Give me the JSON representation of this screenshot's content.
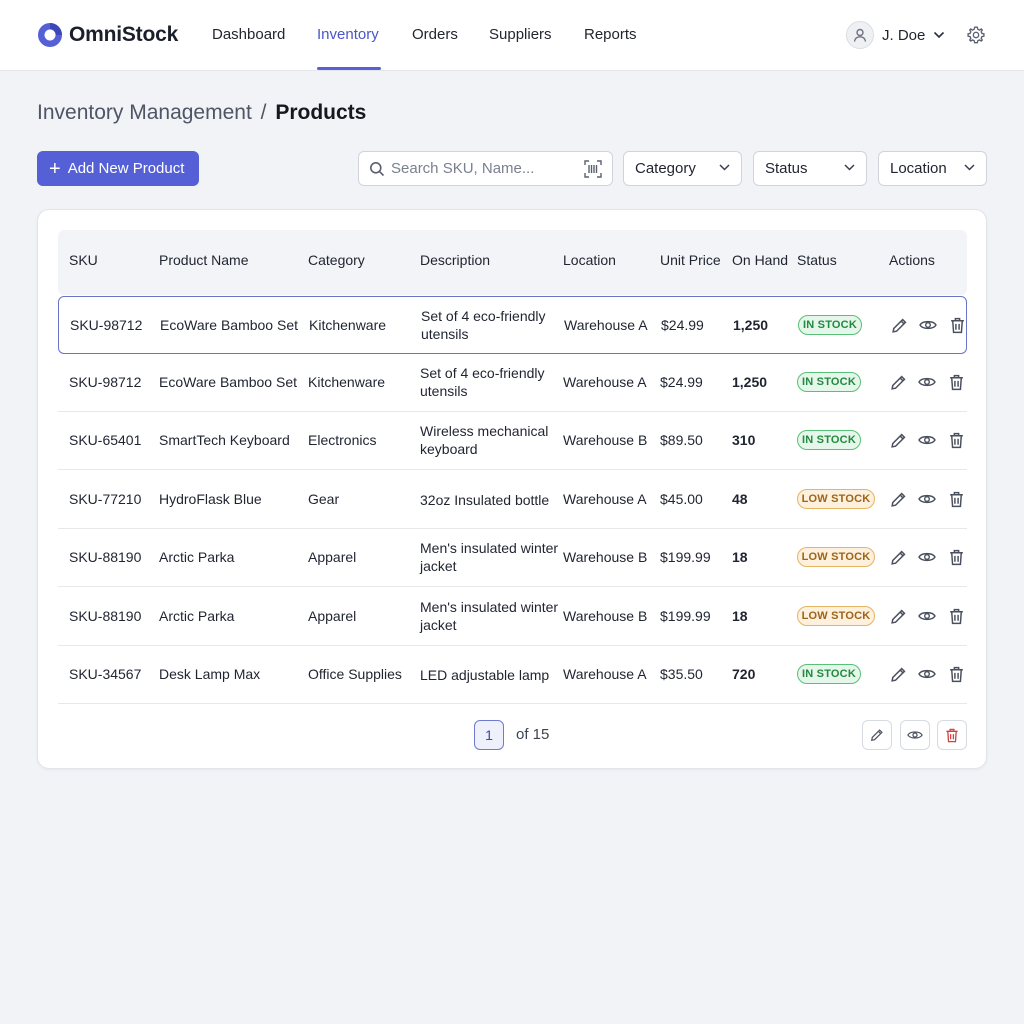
{
  "app": {
    "name": "OmniStock",
    "nav": [
      {
        "label": "Dashboard"
      },
      {
        "label": "Inventory"
      },
      {
        "label": "Orders"
      },
      {
        "label": "Suppliers"
      },
      {
        "label": "Reports"
      }
    ],
    "active_nav": "Inventory",
    "user": {
      "name": "J. Doe"
    }
  },
  "header": {
    "section": "Inventory Management",
    "separator": "/",
    "page": "Products"
  },
  "toolbar": {
    "add_label": "Add New Product",
    "search_placeholder": "Search SKU, Name...",
    "filters": [
      "Category",
      "Status",
      "Location"
    ]
  },
  "table": {
    "columns": [
      "SKU",
      "Product Name",
      "Category",
      "Description",
      "Location",
      "Unit Price",
      "On Hand",
      "Status",
      "Actions"
    ],
    "rows": [
      {
        "sku": "SKU-98712",
        "name": "EcoWare Bamboo Set",
        "category": "Kitchenware",
        "description": "Set of 4 eco-friendly utensils",
        "location": "Warehouse A",
        "price": "$24.99",
        "on_hand": "1,250",
        "status": "IN STOCK",
        "status_type": "in",
        "selected": true
      },
      {
        "sku": "SKU-98712",
        "name": "EcoWare Bamboo Set",
        "category": "Kitchenware",
        "description": "Set of 4 eco-friendly utensils",
        "location": "Warehouse A",
        "price": "$24.99",
        "on_hand": "1,250",
        "status": "IN STOCK",
        "status_type": "in",
        "selected": false
      },
      {
        "sku": "SKU-65401",
        "name": "SmartTech Keyboard",
        "category": "Electronics",
        "description": "Wireless mechanical keyboard",
        "location": "Warehouse B",
        "price": "$89.50",
        "on_hand": "310",
        "status": "IN STOCK",
        "status_type": "in",
        "selected": false
      },
      {
        "sku": "SKU-77210",
        "name": "HydroFlask Blue",
        "category": "Gear",
        "description": "32oz Insulated bottle",
        "location": "Warehouse A",
        "price": "$45.00",
        "on_hand": "48",
        "status": "LOW STOCK",
        "status_type": "low",
        "selected": false
      },
      {
        "sku": "SKU-88190",
        "name": "Arctic Parka",
        "category": "Apparel",
        "description": "Men's insulated winter jacket",
        "location": "Warehouse B",
        "price": "$199.99",
        "on_hand": "18",
        "status": "LOW STOCK",
        "status_type": "low",
        "selected": false
      },
      {
        "sku": "SKU-88190",
        "name": "Arctic Parka",
        "category": "Apparel",
        "description": "Men's insulated winter jacket",
        "location": "Warehouse B",
        "price": "$199.99",
        "on_hand": "18",
        "status": "LOW STOCK",
        "status_type": "low",
        "selected": false
      },
      {
        "sku": "SKU-34567",
        "name": "Desk Lamp Max",
        "category": "Office Supplies",
        "description": "LED adjustable lamp",
        "location": "Warehouse A",
        "price": "$35.50",
        "on_hand": "720",
        "status": "IN STOCK",
        "status_type": "in",
        "selected": false
      }
    ],
    "row_actions": [
      "pencil-icon",
      "eye-icon",
      "trash-icon"
    ]
  },
  "pagination": {
    "current_page": "1",
    "of_label": "of 15"
  },
  "colors": {
    "accent": "#5560d6",
    "in_stock": "#23893f",
    "low_stock": "#9c6519",
    "delete": "#d14343"
  }
}
